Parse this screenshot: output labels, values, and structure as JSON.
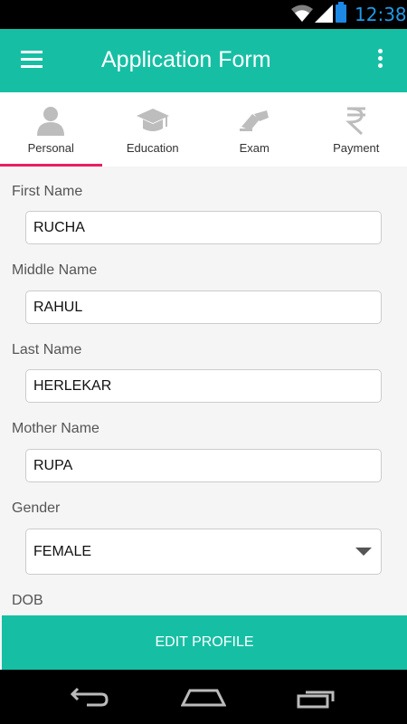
{
  "status_bar": {
    "time": "12:38"
  },
  "app_bar": {
    "title": "Application Form"
  },
  "tabs": [
    {
      "label": "Personal",
      "icon": "person-icon",
      "active": true
    },
    {
      "label": "Education",
      "icon": "graduation-cap-icon",
      "active": false
    },
    {
      "label": "Exam",
      "icon": "exam-icon",
      "active": false
    },
    {
      "label": "Payment",
      "icon": "rupee-icon",
      "active": false
    }
  ],
  "form": {
    "first_name": {
      "label": "First Name",
      "value": "RUCHA"
    },
    "middle_name": {
      "label": "Middle Name",
      "value": "RAHUL"
    },
    "last_name": {
      "label": "Last Name",
      "value": "HERLEKAR"
    },
    "mother_name": {
      "label": "Mother Name",
      "value": "RUPA"
    },
    "gender": {
      "label": "Gender",
      "value": "FEMALE"
    },
    "dob": {
      "label": "DOB"
    }
  },
  "edit_button": {
    "label": "EDIT PROFILE"
  },
  "colors": {
    "accent": "#16bfa4",
    "tab_indicator": "#e91e63",
    "status_time": "#1e9be8"
  }
}
